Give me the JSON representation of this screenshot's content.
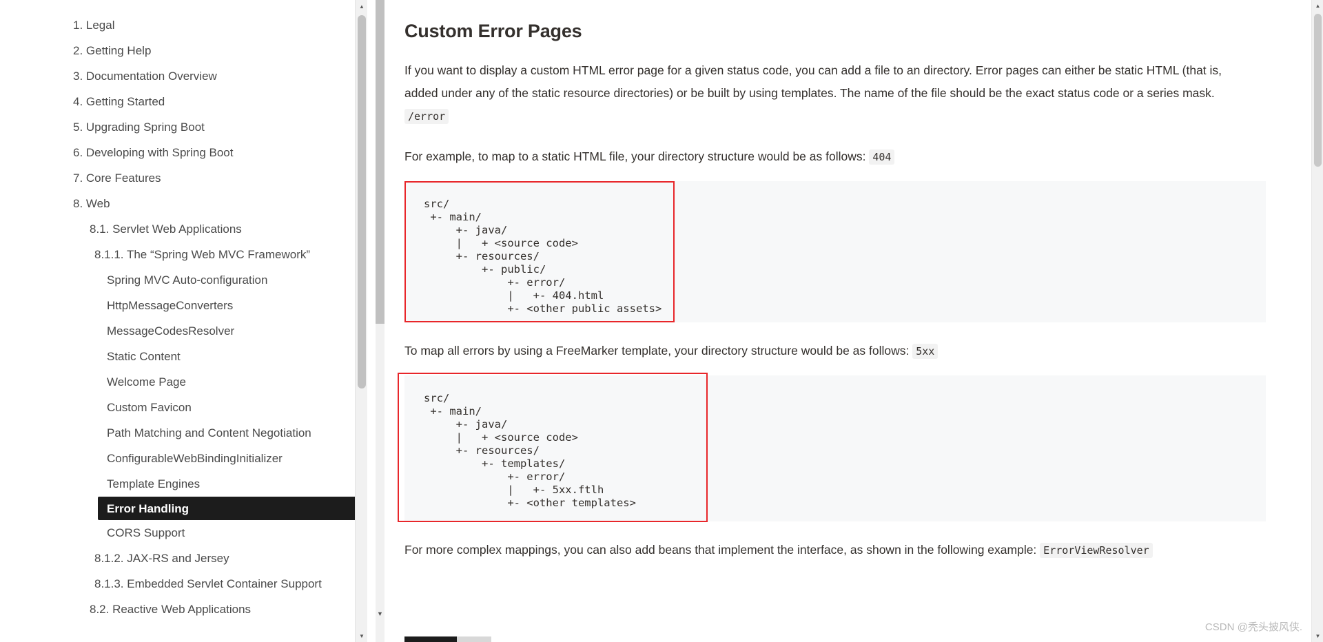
{
  "sidebar": {
    "items": [
      {
        "label": "1. Legal",
        "level": 1,
        "active": false
      },
      {
        "label": "2. Getting Help",
        "level": 1,
        "active": false
      },
      {
        "label": "3. Documentation Overview",
        "level": 1,
        "active": false
      },
      {
        "label": "4. Getting Started",
        "level": 1,
        "active": false
      },
      {
        "label": "5. Upgrading Spring Boot",
        "level": 1,
        "active": false
      },
      {
        "label": "6. Developing with Spring Boot",
        "level": 1,
        "active": false
      },
      {
        "label": "7. Core Features",
        "level": 1,
        "active": false
      },
      {
        "label": "8. Web",
        "level": 1,
        "active": false
      },
      {
        "label": "8.1. Servlet Web Applications",
        "level": 2,
        "active": false
      },
      {
        "label": "8.1.1. The “Spring Web MVC Framework”",
        "level": 3,
        "active": false
      },
      {
        "label": "Spring MVC Auto-configuration",
        "level": 4,
        "active": false
      },
      {
        "label": "HttpMessageConverters",
        "level": 4,
        "active": false
      },
      {
        "label": "MessageCodesResolver",
        "level": 4,
        "active": false
      },
      {
        "label": "Static Content",
        "level": 4,
        "active": false
      },
      {
        "label": "Welcome Page",
        "level": 4,
        "active": false
      },
      {
        "label": "Custom Favicon",
        "level": 4,
        "active": false
      },
      {
        "label": "Path Matching and Content Negotiation",
        "level": 4,
        "active": false
      },
      {
        "label": "ConfigurableWebBindingInitializer",
        "level": 4,
        "active": false
      },
      {
        "label": "Template Engines",
        "level": 4,
        "active": false
      },
      {
        "label": "Error Handling",
        "level": 4,
        "active": true
      },
      {
        "label": "CORS Support",
        "level": 4,
        "active": false
      },
      {
        "label": "8.1.2. JAX-RS and Jersey",
        "level": 3,
        "active": false
      },
      {
        "label": "8.1.3. Embedded Servlet Container Support",
        "level": 3,
        "active": false
      },
      {
        "label": "8.2. Reactive Web Applications",
        "level": 2,
        "active": false
      }
    ],
    "scroll_up_icon": "triangle-up-icon",
    "scroll_down_icon": "triangle-down-icon"
  },
  "main": {
    "title": "Custom Error Pages",
    "paragraph_1": {
      "text_before": "If you want to display a custom HTML error page for a given status code, you can add a file to an directory. Error pages can either be static HTML (that is, added under any of the static resource directories) or be built by using templates. The name of the file should be the exact status code or a series mask. ",
      "code": "/error"
    },
    "paragraph_2": {
      "text_before": "For example, to map to a static HTML file, your directory structure would be as follows: ",
      "code": "404"
    },
    "listing_1": "src/\n +- main/\n     +- java/\n     |   + <source code>\n     +- resources/\n         +- public/\n             +- error/\n             |   +- 404.html\n             +- <other public assets>",
    "paragraph_3": {
      "text_before": "To map all errors by using a FreeMarker template, your directory structure would be as follows: ",
      "code": "5xx"
    },
    "listing_2": "src/\n +- main/\n     +- java/\n     |   + <source code>\n     +- resources/\n         +- templates/\n             +- error/\n             |   +- 5xx.ftlh\n             +- <other templates>",
    "paragraph_4": {
      "text_before": "For more complex mappings, you can also add beans that implement the interface, as shown in the following example: ",
      "code": "ErrorViewResolver"
    },
    "annotation_color": "#e8262a"
  },
  "right_scrollbar": {
    "scroll_up_icon": "triangle-up-icon",
    "scroll_down_icon": "triangle-down-icon"
  },
  "watermark": "CSDN @秃头披风侠."
}
